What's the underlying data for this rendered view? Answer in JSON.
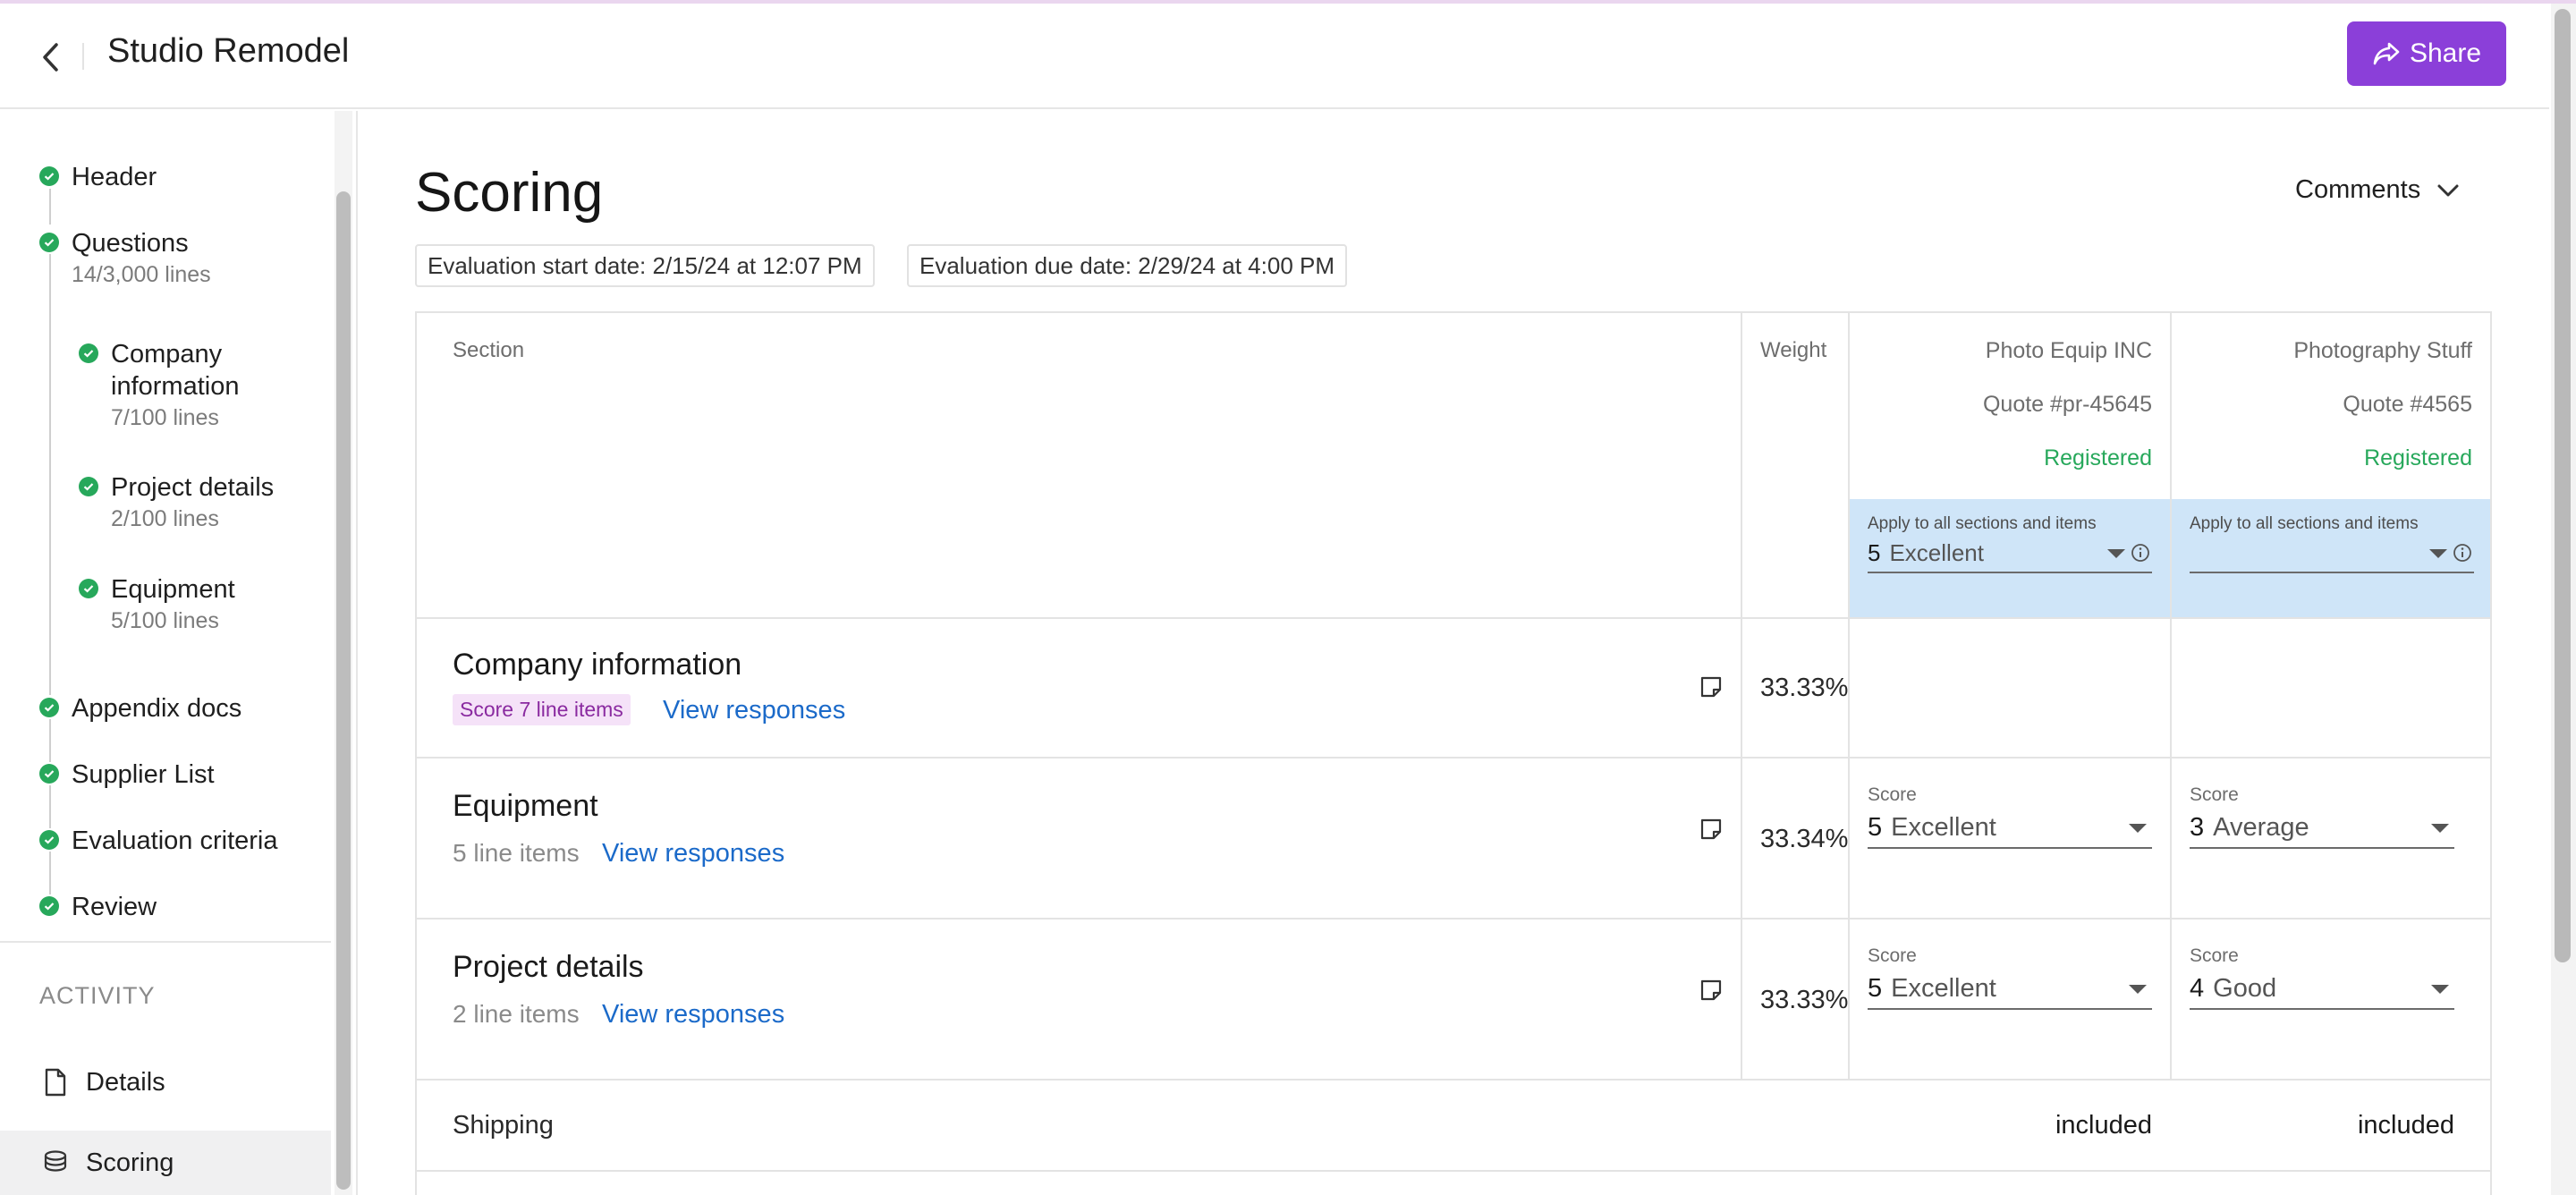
{
  "header": {
    "title": "Studio Remodel",
    "share_label": "Share"
  },
  "sidebar": {
    "steps": [
      {
        "label": "Header"
      },
      {
        "label": "Questions",
        "sub": "14/3,000 lines"
      },
      {
        "label": "Company information",
        "sub": "7/100 lines"
      },
      {
        "label": "Project details",
        "sub": "2/100 lines"
      },
      {
        "label": "Equipment",
        "sub": "5/100 lines"
      },
      {
        "label": "Appendix docs"
      },
      {
        "label": "Supplier List"
      },
      {
        "label": "Evaluation criteria"
      },
      {
        "label": "Review"
      }
    ],
    "activity_heading": "ACTIVITY",
    "activity_items": [
      {
        "label": "Details"
      },
      {
        "label": "Scoring"
      }
    ]
  },
  "main": {
    "title": "Scoring",
    "comments_label": "Comments",
    "start_date": "Evaluation start date: 2/15/24 at 12:07 PM",
    "due_date": "Evaluation due date: 2/29/24 at 4:00 PM"
  },
  "table": {
    "col_section": "Section",
    "col_weight": "Weight",
    "suppliers": [
      {
        "name": "Photo Equip INC",
        "quote": "Quote #pr-45645",
        "status": "Registered",
        "apply_label": "Apply to all sections and items",
        "apply_num": "5",
        "apply_word": "Excellent"
      },
      {
        "name": "Photography Stuff",
        "quote": "Quote #4565",
        "status": "Registered",
        "apply_label": "Apply to all sections and items",
        "apply_num": "",
        "apply_word": ""
      }
    ],
    "rows": [
      {
        "title": "Company information",
        "tag": "Score 7 line items",
        "link": "View responses",
        "weight": "33.33%"
      },
      {
        "title": "Equipment",
        "count": "5 line items",
        "link": "View responses",
        "weight": "33.34%",
        "scores": [
          {
            "label": "Score",
            "num": "5",
            "word": "Excellent"
          },
          {
            "label": "Score",
            "num": "3",
            "word": "Average"
          }
        ]
      },
      {
        "title": "Project details",
        "count": "2 line items",
        "link": "View responses",
        "weight": "33.33%",
        "scores": [
          {
            "label": "Score",
            "num": "5",
            "word": "Excellent"
          },
          {
            "label": "Score",
            "num": "4",
            "word": "Good"
          }
        ]
      }
    ],
    "shipping": {
      "label": "Shipping",
      "values": [
        "included",
        "included"
      ]
    }
  },
  "colors": {
    "accent": "#8b3fd9",
    "success": "#27a85b",
    "link": "#1b6ac9",
    "apply_bg": "#cfe5f8",
    "tag_bg": "#f5e2f8"
  }
}
